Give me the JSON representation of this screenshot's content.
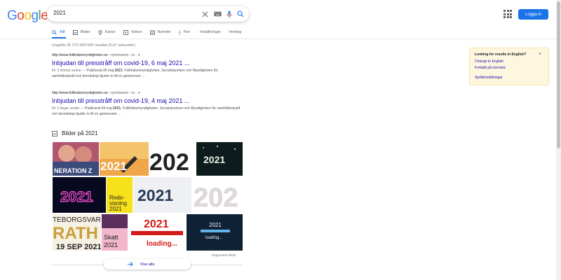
{
  "header": {
    "logo_letters": [
      {
        "ch": "G",
        "color": "#4285f4"
      },
      {
        "ch": "o",
        "color": "#ea4335"
      },
      {
        "ch": "o",
        "color": "#fbbc05"
      },
      {
        "ch": "g",
        "color": "#4285f4"
      },
      {
        "ch": "l",
        "color": "#34a853"
      },
      {
        "ch": "e",
        "color": "#ea4335"
      }
    ],
    "search_query": "2021",
    "login_label": "Logga in",
    "icons": [
      "clear-icon",
      "keyboard-icon",
      "mic-icon",
      "search-icon",
      "apps-icon"
    ]
  },
  "tabs": [
    {
      "label": "Allt",
      "icon": "search-icon",
      "active": true
    },
    {
      "label": "Bilder",
      "icon": "image-icon"
    },
    {
      "label": "Kartor",
      "icon": "map-pin-icon"
    },
    {
      "label": "Videor",
      "icon": "video-icon"
    },
    {
      "label": "Nyheter",
      "icon": "news-icon"
    },
    {
      "label": "Fler",
      "icon": "more-icon"
    }
  ],
  "tools": {
    "settings": "Inställningar",
    "tools": "Verktyg"
  },
  "stats": "Ungefär 25 270 000 000 resultat (0,67 sekunder)",
  "results": [
    {
      "cite": "http://www.folkhalsomyndigheten.se",
      "path": " › nyhetsarkiv › in... ▾",
      "title": "Inbjudan till presstråff om covid-19, 6 maj 2021 ...",
      "date": "för 3 timmar sedan — ",
      "snippet_pre": "Publicerat 06 maj ",
      "snippet_bold": "2021",
      "snippet_post": ". Folkhälsomyndigheten, Socialstyrelsen och Myndigheten för samhällsskydd och beredskap bjuder in till en gemensam ..."
    },
    {
      "cite": "http://www.folkhalsomyndigheten.se",
      "path": " › nyhetsarkiv › in... ▾",
      "title": "Inbjudan till presstråff om covid-19, 4 maj 2021 ...",
      "date": "för 2 dagar sedan — ",
      "snippet_pre": "Publicerat 04 maj ",
      "snippet_bold": "2021",
      "snippet_post": ". Folkhälsomyndigheten, Socialstyrelsen och Myndigheten för samhällsskydd och beredskap bjuder in till en gemensam ..."
    }
  ],
  "images": {
    "heading": "Bilder på 2021",
    "tiles": [
      {
        "text": "NERATION Z"
      },
      {
        "text": "2021"
      },
      {
        "text": "202"
      },
      {
        "text": "2021"
      },
      {
        "text": "2021"
      },
      {
        "text": "Redo-\nvisning\n2021"
      },
      {
        "text": "2021"
      },
      {
        "text": "202"
      },
      {
        "text": "TEBORGSVAR\nRATH\n19 SEP 2021"
      },
      {
        "text": "Skatt\n2021"
      },
      {
        "text": "2021\nloading..."
      },
      {
        "text": "2021\nloading..."
      }
    ],
    "report": "Rapportera bilder",
    "more": "Visa alla"
  },
  "notice": {
    "title": "Looking for results in English?",
    "link1": "Change to English",
    "link2": "Fortsätt på svenska",
    "link3": "Språkinställningar"
  },
  "colors": {
    "link": "#1a0dab",
    "accent": "#1a73e8",
    "notice_bg": "#fef7e0"
  }
}
